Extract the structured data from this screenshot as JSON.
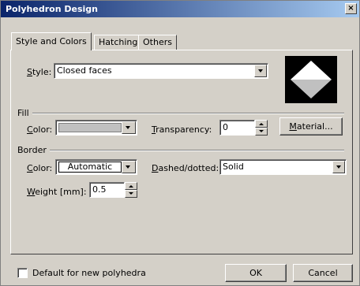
{
  "window": {
    "title": "Polyhedron Design",
    "close_glyph": "×"
  },
  "tabs": [
    {
      "label": "Style and Colors",
      "active": true
    },
    {
      "label": "Hatching",
      "active": false
    },
    {
      "label": "Others",
      "active": false
    }
  ],
  "style": {
    "label_underlined": "S",
    "label_rest": "tyle:",
    "value": "Closed faces"
  },
  "fill": {
    "group_label": "Fill",
    "color_label_underlined": "C",
    "color_label_rest": "olor:",
    "color_value": "#c0c0c0",
    "transparency_label_underlined": "T",
    "transparency_label_rest": "ransparency:",
    "transparency_value": "0",
    "material_underlined": "M",
    "material_rest": "aterial..."
  },
  "border": {
    "group_label": "Border",
    "color_label_underlined": "C",
    "color_label_rest": "olor:",
    "color_value": "Automatic",
    "dashed_label_underlined": "D",
    "dashed_label_rest": "ashed/dotted:",
    "dashed_value": "Solid",
    "weight_label_underlined": "W",
    "weight_label_rest": "eight [mm]:",
    "weight_value": "0.5"
  },
  "footer": {
    "default_checkbox_label": "Default for new polyhedra",
    "default_checked": false,
    "ok_label": "OK",
    "cancel_label": "Cancel"
  },
  "colors": {
    "titlebar_start": "#0a246a",
    "titlebar_end": "#a6caf0",
    "dialog_bg": "#d4d0c8",
    "preview_top": "#ffffff",
    "preview_bottom": "#c0c0c0"
  }
}
